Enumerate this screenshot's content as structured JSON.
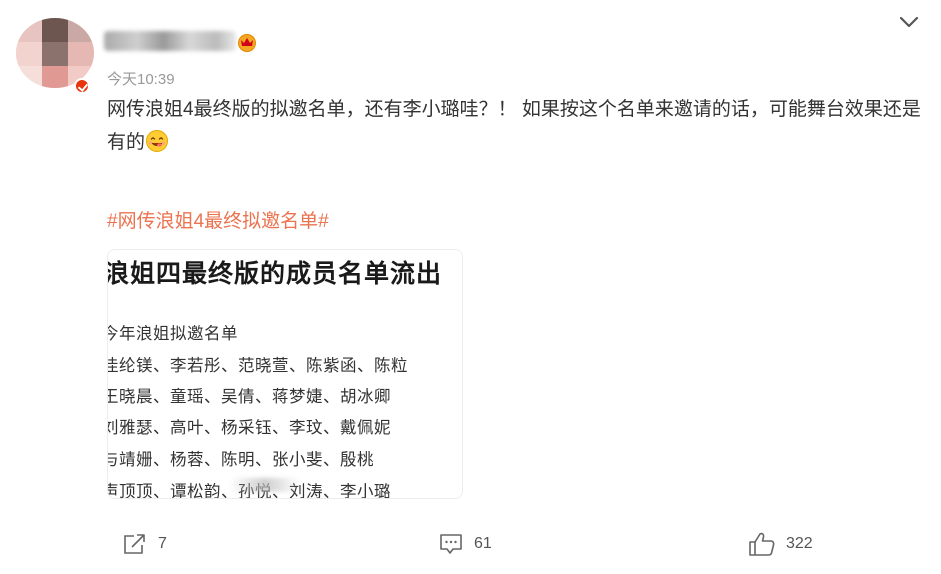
{
  "post": {
    "timestamp": "今天10:39",
    "text_main": "网传浪姐4最终版的拟邀名单，还有李小璐哇？！ 如果按这个名单来邀请的话，可能舞台效果还是有的",
    "topic": "#网传浪姐4最终拟邀名单#"
  },
  "image": {
    "title": "浪姐四最终版的成员名单流出",
    "lines": [
      "今年浪姐拟邀名单",
      "佳纶镁、李若彤、范晓萱、陈紫函、陈粒",
      "王晓晨、童瑶、吴倩、蒋梦婕、胡冰卿",
      "刘雅瑟、高叶、杨采钰、李玟、戴佩妮",
      "与靖姗、杨蓉、陈明、张小斐、殷桃",
      "声顶顶、谭松韵、孙悦、刘涛、李小璐"
    ]
  },
  "actions": {
    "share_count": "7",
    "comment_count": "61",
    "like_count": "322"
  },
  "colors": {
    "topic": "#eb7350",
    "verified": "#e8340a",
    "timestamp": "#999999"
  },
  "icons": {
    "verified": "verified-badge-icon",
    "crown": "crown-badge-icon",
    "collapse": "chevron-down-icon",
    "emoji": "yummy-face-emoji-icon",
    "share": "share-icon",
    "comment": "comment-icon",
    "like": "thumbs-up-icon"
  }
}
